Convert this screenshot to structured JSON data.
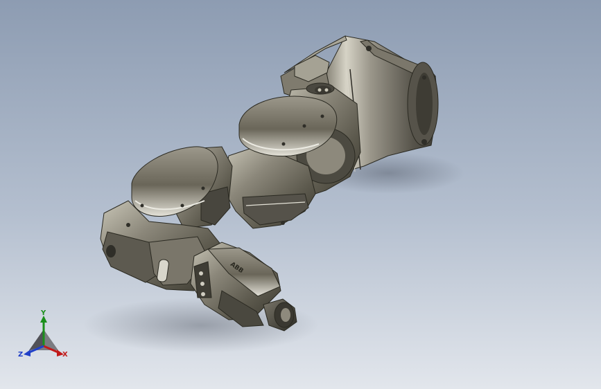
{
  "viewport": {
    "background_top": "#8d9cb2",
    "background_bottom": "#e2e6ec"
  },
  "model": {
    "logo_text": "ABB",
    "body_color": "#6f6b5c",
    "highlight_color": "#e9e7dc",
    "shadow_color": "#2a2921"
  },
  "triad": {
    "y_label": "Y",
    "x_label": "X",
    "z_label": "Z",
    "y_color": "#1a8f1a",
    "x_color": "#c11a1a",
    "z_color": "#2040c8"
  }
}
